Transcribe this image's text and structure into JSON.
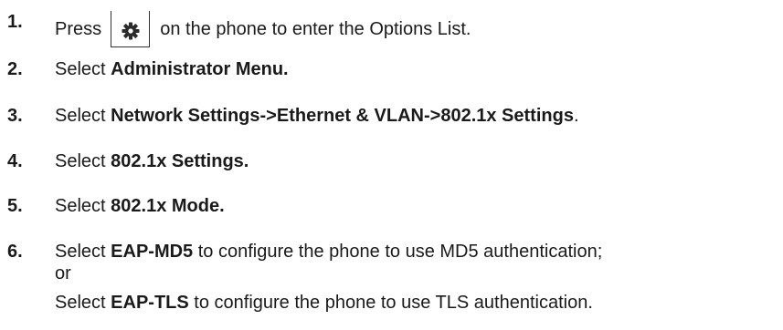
{
  "steps": [
    {
      "number": "1.",
      "before": "Press",
      "icon": "gear-icon",
      "after": "on the phone to enter the Options List."
    },
    {
      "number": "2.",
      "before": "Select ",
      "bold": "Administrator Menu."
    },
    {
      "number": "3.",
      "before": "Select ",
      "bold": "Network Settings->Ethernet & VLAN->802.1x Settings",
      "after": "."
    },
    {
      "number": "4.",
      "before": "Select ",
      "bold": "802.1x Settings."
    },
    {
      "number": "5.",
      "before": "Select ",
      "bold": "802.1x Mode."
    },
    {
      "number": "6.",
      "line1_before": "Select ",
      "line1_bold": "EAP-MD5",
      "line1_after": " to configure the phone to use MD5 authentication;",
      "line2": "or",
      "line3_before": "Select ",
      "line3_bold": "EAP-TLS",
      "line3_after": " to configure the phone to use TLS authentication."
    }
  ]
}
